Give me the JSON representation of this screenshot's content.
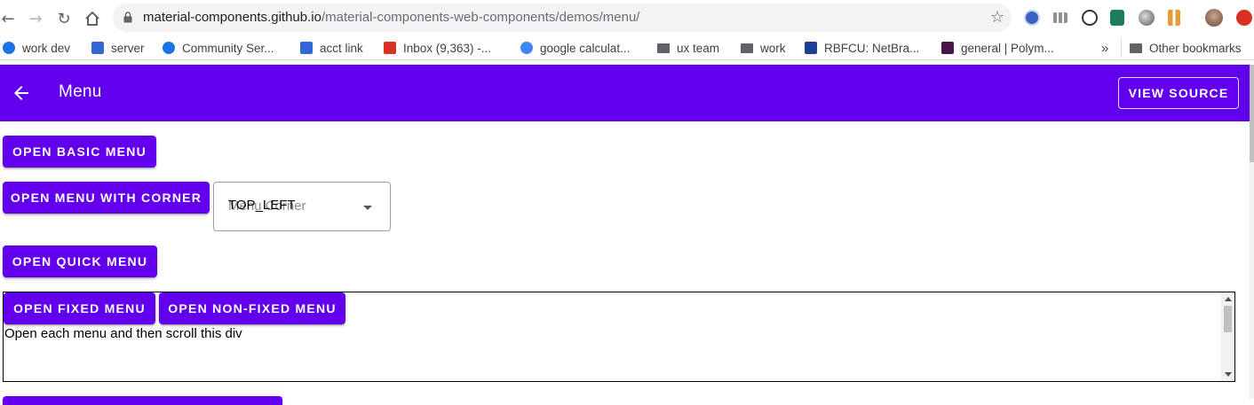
{
  "browser": {
    "url_host": "material-components.github.io",
    "url_path": "/material-components-web-components/demos/menu/",
    "bookmarks": [
      {
        "label": "work dev",
        "icon": "globe-icon",
        "color": "#1a73e8"
      },
      {
        "label": "server",
        "icon": "code-icon",
        "color": "#3367d6"
      },
      {
        "label": "Community Ser...",
        "icon": "globe-icon",
        "color": "#1a73e8"
      },
      {
        "label": "acct link",
        "icon": "code-icon",
        "color": "#3367d6"
      },
      {
        "label": "Inbox (9,363) -...",
        "icon": "gmail-icon",
        "color": "#d93025"
      },
      {
        "label": "google calculat...",
        "icon": "google-icon",
        "color": "#4285f4"
      },
      {
        "label": "ux team",
        "icon": "folder-icon",
        "color": "#5f6368"
      },
      {
        "label": "work",
        "icon": "folder-icon",
        "color": "#5f6368"
      },
      {
        "label": "RBFCU: NetBra...",
        "icon": "star-badge-icon",
        "color": "#1c3f94"
      },
      {
        "label": "general | Polym...",
        "icon": "slack-icon",
        "color": "#4a154b"
      }
    ],
    "overflow_label": "»",
    "other_bookmarks": "Other bookmarks"
  },
  "appbar": {
    "title": "Menu",
    "view_source": "VIEW SOURCE",
    "color": "#6200ee"
  },
  "main": {
    "open_basic_menu": "OPEN BASIC MENU",
    "open_menu_with_corner": "OPEN MENU WITH CORNER",
    "corner_select_label": "Menu Corner",
    "corner_select_value": "TOP_LEFT",
    "open_quick_menu": "OPEN QUICK MENU",
    "open_fixed_menu": "OPEN FIXED MENU",
    "open_non_fixed_menu": "OPEN NON-FIXED MENU",
    "scroll_text": "Open each menu and then scroll this div"
  }
}
